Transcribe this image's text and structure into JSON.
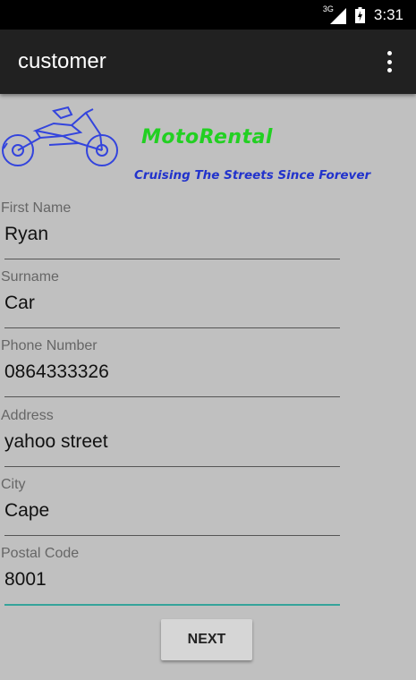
{
  "status_bar": {
    "network": "3G",
    "time": "3:31"
  },
  "app_bar": {
    "title": "customer"
  },
  "logo": {
    "brand": "MotoRental",
    "tagline": "Cruising The Streets Since Forever"
  },
  "form": {
    "fields": [
      {
        "label": "First Name",
        "value": "Ryan"
      },
      {
        "label": "Surname",
        "value": "Car"
      },
      {
        "label": "Phone Number",
        "value": "0864333326"
      },
      {
        "label": "Address",
        "value": "yahoo street"
      },
      {
        "label": "City",
        "value": "Cape"
      },
      {
        "label": "Postal Code",
        "value": "8001"
      }
    ]
  },
  "actions": {
    "next_label": "NEXT"
  },
  "colors": {
    "app_bar": "#212121",
    "background": "#c0c0c0",
    "brand_green": "#22d022",
    "tagline_blue": "#2233cc",
    "accent_teal": "#35a39a"
  }
}
